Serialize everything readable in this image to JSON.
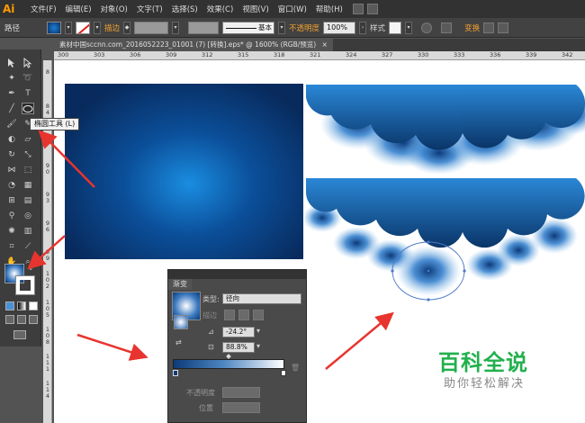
{
  "app": {
    "logo": "Ai"
  },
  "menu": [
    "文件(F)",
    "编辑(E)",
    "对象(O)",
    "文字(T)",
    "选择(S)",
    "效果(C)",
    "视图(V)",
    "窗口(W)",
    "帮助(H)"
  ],
  "control_bar": {
    "object_type": "路径",
    "stroke_label": "描边",
    "stroke_style": "基本",
    "opacity_label": "不透明度",
    "opacity_value": "100%",
    "style_label": "样式",
    "transform_label": "变换"
  },
  "document_tab": {
    "title": "素材中国sccnn.com_2016052223_01001 (7) [转换].eps* @ 1600% (RGB/预览)",
    "close": "×"
  },
  "rulers": {
    "top": [
      "300",
      "303",
      "306",
      "309",
      "312",
      "315",
      "318",
      "321",
      "324",
      "327",
      "330",
      "333",
      "336",
      "339",
      "342"
    ],
    "left": [
      "8",
      "8 4",
      "8 7",
      "9 0",
      "9 3",
      "9 6",
      "9 9",
      "1 0 2",
      "1 0 5",
      "1 0 8",
      "1 1 1",
      "1 1 4"
    ]
  },
  "tooltip": {
    "text": "椭圆工具 (L)"
  },
  "gradient_panel": {
    "tab_label": "渐变",
    "type_label": "类型:",
    "type_value": "径向",
    "stroke_label": "描边",
    "angle_value": "-24.2°",
    "ratio_value": "88.8%",
    "opacity_label": "不透明度",
    "location_label": "位置"
  },
  "watermark": {
    "title": "百科全说",
    "subtitle": "助你轻松解决"
  },
  "colors": {
    "accent_orange": "#f0a030",
    "gradient_dark": "#082a5c",
    "gradient_light": "#1a8de0",
    "arrow_red": "#e8342e",
    "watermark_green": "#22b04d"
  }
}
